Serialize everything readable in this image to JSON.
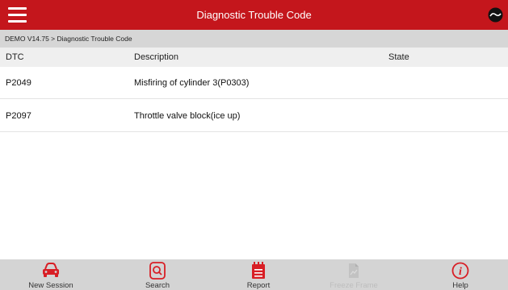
{
  "header": {
    "title": "Diagnostic Trouble Code",
    "colors": {
      "bar": "#c4161c",
      "breadcrumb_bg": "#d6d6d6"
    }
  },
  "breadcrumb": "DEMO V14.75 > Diagnostic Trouble Code",
  "table": {
    "columns": [
      "DTC",
      "Description",
      "State"
    ],
    "rows": [
      {
        "dtc": "P2049",
        "description": "Misfiring of cylinder 3(P0303)",
        "state": ""
      },
      {
        "dtc": "P2097",
        "description": "Throttle valve block(ice up)",
        "state": ""
      }
    ]
  },
  "bottom_nav": {
    "items": [
      {
        "label": "New Session",
        "icon": "car-icon",
        "enabled": true
      },
      {
        "label": "Search",
        "icon": "search-icon",
        "enabled": true
      },
      {
        "label": "Report",
        "icon": "report-icon",
        "enabled": true
      },
      {
        "label": "Freeze Frame",
        "icon": "freeze-frame-icon",
        "enabled": false
      },
      {
        "label": "Help",
        "icon": "help-icon",
        "enabled": true
      }
    ],
    "accent": "#d81e25"
  }
}
